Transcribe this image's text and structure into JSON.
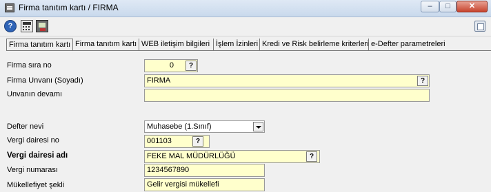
{
  "window": {
    "title": "Firma tanıtım kartı / FIRMA",
    "min_glyph": "–",
    "max_glyph": "□",
    "close_glyph": "✕"
  },
  "toolbar": {
    "help_glyph": "?"
  },
  "tabs": [
    {
      "label": "Firma tanıtım kartı"
    },
    {
      "label": "Firma tanıtım kartı"
    },
    {
      "label": "WEB iletişim bilgileri"
    },
    {
      "label": "İşlem İzinleri"
    },
    {
      "label": "Kredi ve Risk belirleme kriterleri"
    },
    {
      "label": "e-Defter parametreleri"
    }
  ],
  "form": {
    "firma_sira_no": {
      "label": "Firma sıra no",
      "value": "0"
    },
    "firma_unvani": {
      "label": "Firma Unvanı (Soyadı)",
      "value": "FIRMA"
    },
    "unvan_devami": {
      "label": "Unvanın devamı",
      "value": ""
    },
    "defter_nevi": {
      "label": "Defter nevi",
      "value": "Muhasebe (1.Sınıf)"
    },
    "vergi_dairesi_no": {
      "label": "Vergi dairesi no",
      "value": "001103"
    },
    "vergi_dairesi_adi": {
      "label": "Vergi dairesi adı",
      "value": "FEKE MAL MÜDÜRLÜĞÜ"
    },
    "vergi_numarasi": {
      "label": "Vergi numarası",
      "value": "1234567890"
    },
    "mukellefiyet": {
      "label": "Mükellefiyet şekli",
      "value": "Gelir vergisi mükellefi"
    },
    "lookup_glyph": "?"
  }
}
